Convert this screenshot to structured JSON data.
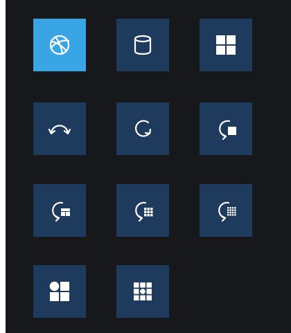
{
  "toolbar": {
    "buttons": [
      {
        "icon": "globe-icon",
        "state": "active"
      },
      {
        "icon": "database-icon"
      },
      {
        "icon": "tiles-2x2-icon"
      },
      {
        "icon": "arc-arrows-icon"
      },
      {
        "icon": "rotate-icon"
      },
      {
        "icon": "rotate-single-square-icon"
      },
      {
        "icon": "rotate-grid-small-icon"
      },
      {
        "icon": "rotate-grid-medium-icon"
      },
      {
        "icon": "rotate-grid-fine-icon"
      },
      {
        "icon": "circle-and-squares-icon"
      },
      {
        "icon": "grid-dot-icon"
      }
    ]
  },
  "colors": {
    "panel_background": "#17181b",
    "tile_background": "#1e3a5c",
    "tile_active_background": "#3aa5e4",
    "icon_color": "#ffffff"
  }
}
